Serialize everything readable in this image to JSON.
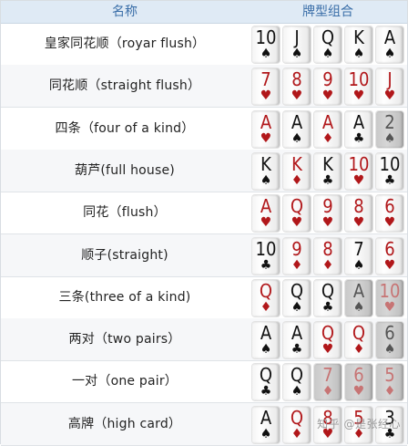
{
  "header": {
    "name": "名称",
    "combo": "牌型组合"
  },
  "rows": [
    {
      "name": "皇家同花顺（royar flush）",
      "cards": [
        {
          "rank": "10",
          "suit": "♠",
          "color": "black",
          "dim": false
        },
        {
          "rank": "J",
          "suit": "♠",
          "color": "black",
          "dim": false
        },
        {
          "rank": "Q",
          "suit": "♠",
          "color": "black",
          "dim": false
        },
        {
          "rank": "K",
          "suit": "♠",
          "color": "black",
          "dim": false
        },
        {
          "rank": "A",
          "suit": "♠",
          "color": "black",
          "dim": false
        }
      ]
    },
    {
      "name": "同花顺（straight flush）",
      "cards": [
        {
          "rank": "7",
          "suit": "♥",
          "color": "red",
          "dim": false
        },
        {
          "rank": "8",
          "suit": "♥",
          "color": "red",
          "dim": false
        },
        {
          "rank": "9",
          "suit": "♥",
          "color": "red",
          "dim": false
        },
        {
          "rank": "10",
          "suit": "♥",
          "color": "red",
          "dim": false
        },
        {
          "rank": "J",
          "suit": "♥",
          "color": "red",
          "dim": false
        }
      ]
    },
    {
      "name": "四条（four of a kind）",
      "cards": [
        {
          "rank": "A",
          "suit": "♥",
          "color": "red",
          "dim": false
        },
        {
          "rank": "A",
          "suit": "♠",
          "color": "black",
          "dim": false
        },
        {
          "rank": "A",
          "suit": "♦",
          "color": "red",
          "dim": false
        },
        {
          "rank": "A",
          "suit": "♣",
          "color": "black",
          "dim": false
        },
        {
          "rank": "2",
          "suit": "♠",
          "color": "black",
          "dim": true
        }
      ]
    },
    {
      "name": "葫芦(full house)",
      "cards": [
        {
          "rank": "K",
          "suit": "♠",
          "color": "black",
          "dim": false
        },
        {
          "rank": "K",
          "suit": "♦",
          "color": "red",
          "dim": false
        },
        {
          "rank": "K",
          "suit": "♣",
          "color": "black",
          "dim": false
        },
        {
          "rank": "10",
          "suit": "♥",
          "color": "red",
          "dim": false
        },
        {
          "rank": "10",
          "suit": "♣",
          "color": "black",
          "dim": false
        }
      ]
    },
    {
      "name": "同花（flush）",
      "cards": [
        {
          "rank": "A",
          "suit": "♥",
          "color": "red",
          "dim": false
        },
        {
          "rank": "Q",
          "suit": "♥",
          "color": "red",
          "dim": false
        },
        {
          "rank": "9",
          "suit": "♥",
          "color": "red",
          "dim": false
        },
        {
          "rank": "8",
          "suit": "♥",
          "color": "red",
          "dim": false
        },
        {
          "rank": "6",
          "suit": "♥",
          "color": "red",
          "dim": false
        }
      ]
    },
    {
      "name": "顺子(straight)",
      "cards": [
        {
          "rank": "10",
          "suit": "♣",
          "color": "black",
          "dim": false
        },
        {
          "rank": "9",
          "suit": "♦",
          "color": "red",
          "dim": false
        },
        {
          "rank": "8",
          "suit": "♦",
          "color": "red",
          "dim": false
        },
        {
          "rank": "7",
          "suit": "♠",
          "color": "black",
          "dim": false
        },
        {
          "rank": "6",
          "suit": "♥",
          "color": "red",
          "dim": false
        }
      ]
    },
    {
      "name": "三条(three of a kind)",
      "cards": [
        {
          "rank": "Q",
          "suit": "♦",
          "color": "red",
          "dim": false
        },
        {
          "rank": "Q",
          "suit": "♠",
          "color": "black",
          "dim": false
        },
        {
          "rank": "Q",
          "suit": "♣",
          "color": "black",
          "dim": false
        },
        {
          "rank": "A",
          "suit": "♠",
          "color": "black",
          "dim": true
        },
        {
          "rank": "10",
          "suit": "♥",
          "color": "red",
          "dim": true
        }
      ]
    },
    {
      "name": "两对（two pairs）",
      "cards": [
        {
          "rank": "A",
          "suit": "♠",
          "color": "black",
          "dim": false
        },
        {
          "rank": "A",
          "suit": "♣",
          "color": "black",
          "dim": false
        },
        {
          "rank": "Q",
          "suit": "♥",
          "color": "red",
          "dim": false
        },
        {
          "rank": "Q",
          "suit": "♦",
          "color": "red",
          "dim": false
        },
        {
          "rank": "6",
          "suit": "♠",
          "color": "black",
          "dim": true
        }
      ]
    },
    {
      "name": "一对（one pair）",
      "cards": [
        {
          "rank": "Q",
          "suit": "♣",
          "color": "black",
          "dim": false
        },
        {
          "rank": "Q",
          "suit": "♠",
          "color": "black",
          "dim": false
        },
        {
          "rank": "7",
          "suit": "♦",
          "color": "red",
          "dim": true
        },
        {
          "rank": "6",
          "suit": "♥",
          "color": "red",
          "dim": true
        },
        {
          "rank": "5",
          "suit": "♦",
          "color": "red",
          "dim": true
        }
      ]
    },
    {
      "name": "高牌（high card）",
      "cards": [
        {
          "rank": "A",
          "suit": "♠",
          "color": "black",
          "dim": false
        },
        {
          "rank": "Q",
          "suit": "♦",
          "color": "red",
          "dim": false
        },
        {
          "rank": "8",
          "suit": "♥",
          "color": "red",
          "dim": false
        },
        {
          "rank": "5",
          "suit": "♦",
          "color": "red",
          "dim": false
        },
        {
          "rank": "3",
          "suit": "♣",
          "color": "black",
          "dim": false
        }
      ]
    }
  ],
  "watermark": "知乎 @是张经心"
}
